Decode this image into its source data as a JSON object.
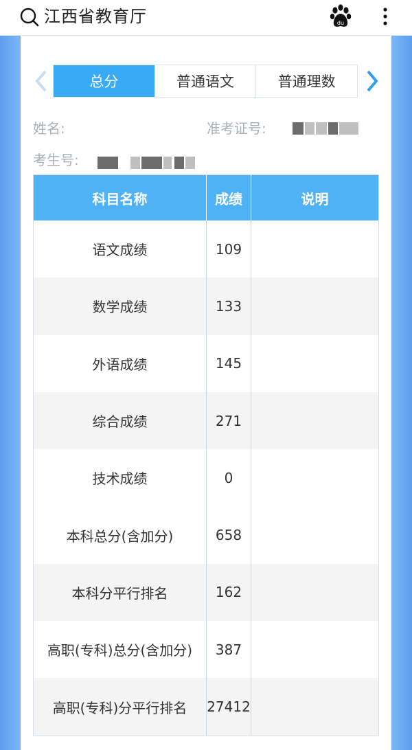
{
  "header": {
    "site_title": "江西省教育厅"
  },
  "tabs": [
    {
      "label": "总分",
      "active": true
    },
    {
      "label": "普通语文",
      "active": false
    },
    {
      "label": "普通理数",
      "active": false
    }
  ],
  "info": {
    "name_label": "姓名:",
    "ticket_label": "准考证号:",
    "student_no_label": "考生号:"
  },
  "table": {
    "headers": [
      "科目名称",
      "成绩",
      "说明"
    ],
    "rows": [
      {
        "subject": "语文成绩",
        "score": "109",
        "note": ""
      },
      {
        "subject": "数学成绩",
        "score": "133",
        "note": ""
      },
      {
        "subject": "外语成绩",
        "score": "145",
        "note": ""
      },
      {
        "subject": "综合成绩",
        "score": "271",
        "note": ""
      },
      {
        "subject": "技术成绩",
        "score": "0",
        "note": ""
      },
      {
        "subject": "本科总分(含加分)",
        "score": "658",
        "note": ""
      },
      {
        "subject": "本科分平行排名",
        "score": "162",
        "note": ""
      },
      {
        "subject": "高职(专科)总分(含加分)",
        "score": "387",
        "note": ""
      },
      {
        "subject": "高职(专科)分平行排名",
        "score": "27412",
        "note": ""
      }
    ]
  },
  "colors": {
    "accent": "#39aaf6",
    "header_bg": "#4fb2f4",
    "frame": "#6aa9f0"
  }
}
